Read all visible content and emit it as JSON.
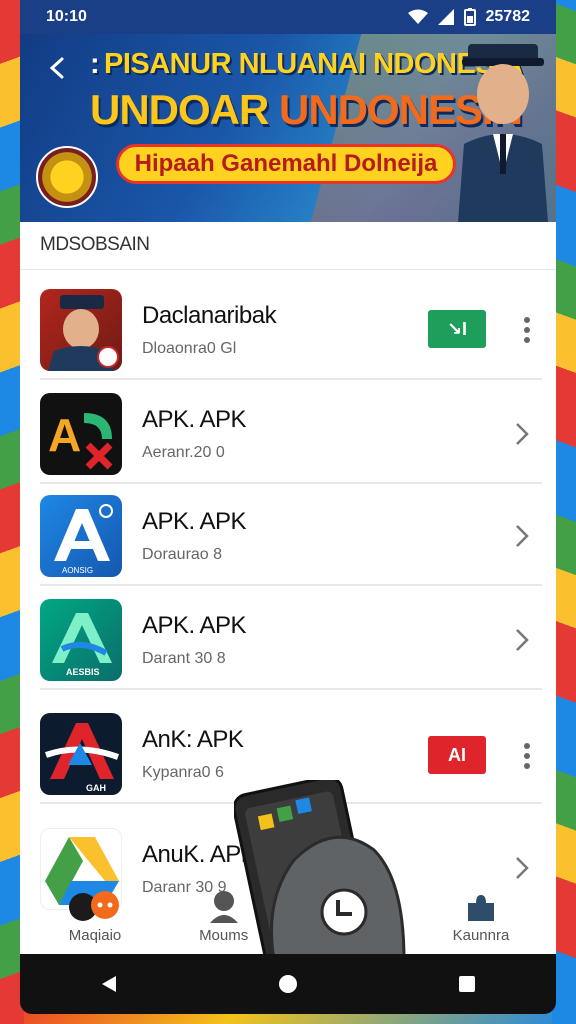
{
  "status_bar": {
    "time": "10:10",
    "battery_text": "25782"
  },
  "header": {
    "title": "PISANUR NLUANAI NDONESIA",
    "subtitle_part1": "UNDOAR",
    "subtitle_part2": "UNDONESIN",
    "pill_text": "Hipaah Ganemahl Dolneija",
    "back_colon": ":"
  },
  "section": {
    "title": "MDSOBSAIN"
  },
  "apps": [
    {
      "name": "Daclanaribak",
      "meta": "Dloaonra0 Gl",
      "action": "install-green"
    },
    {
      "name": "APK. APK",
      "meta": "Aeranr.20 0",
      "action": "chevron"
    },
    {
      "name": "APK. APK",
      "meta": "Doraurao 8",
      "action": "chevron"
    },
    {
      "name": "APK. APK",
      "meta": "Darant 30 8",
      "action": "chevron"
    },
    {
      "name": "AnK: APK",
      "meta": "Kypanra0 6",
      "action": "install-red"
    },
    {
      "name": "AnuK. APK",
      "meta": "Daranr 30 9",
      "action": "chevron"
    }
  ],
  "buttons": {
    "green_label": "↘I",
    "red_label": "AI"
  },
  "icon_text": {
    "app5": "GAH",
    "app4": "AESBIS",
    "app3": "AONSIG"
  },
  "bottom_nav": [
    {
      "label": "Maqiaio",
      "icon": "chat-icon"
    },
    {
      "label": "Moums",
      "icon": "person-icon"
    },
    {
      "label": "Kaunnra",
      "icon": "puzzle-icon"
    }
  ],
  "colors": {
    "green": "#1e9e5a",
    "red": "#e0242b",
    "banner": "#1a56a8",
    "yellow": "#ffd21f"
  }
}
